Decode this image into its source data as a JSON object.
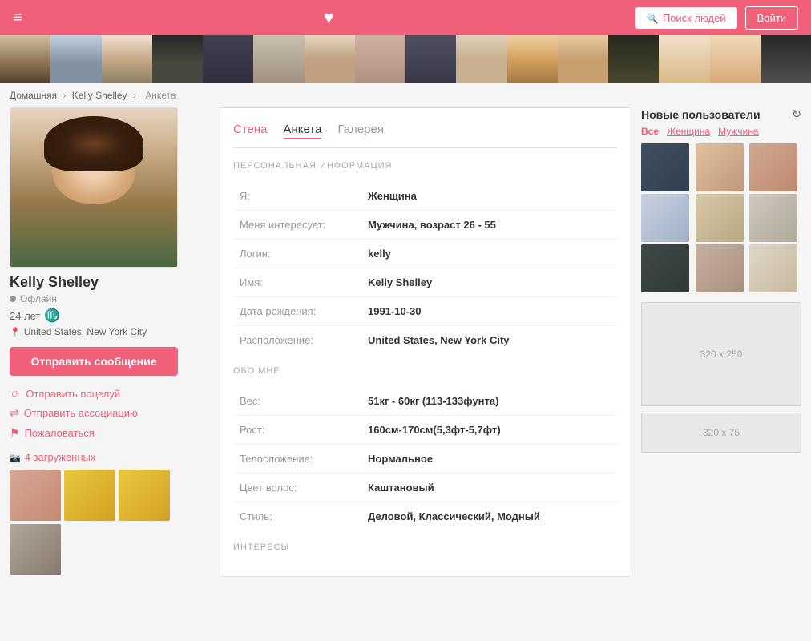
{
  "header": {
    "search_btn": "Поиск людей",
    "login_btn": "Войти",
    "heart": "♥"
  },
  "breadcrumb": {
    "home": "Домашняя",
    "sep1": ">",
    "user": "Kelly Shelley",
    "sep2": ">",
    "page": "Анкета"
  },
  "profile": {
    "name": "Kelly Shelley",
    "status": "Офлайн",
    "age": "24 лет",
    "zodiac": "♏",
    "location": "United States, New York City",
    "send_msg": "Отправить сообщение",
    "kiss_link": "Отправить поцелуй",
    "assoc_link": "Отправить ассоциацию",
    "complaint_link": "Пожаловаться",
    "photos_label": "4 загруженных"
  },
  "tabs": {
    "wall": "Стена",
    "anketa": "Анкета",
    "gallery": "Галерея"
  },
  "sections": {
    "personal_info": "ПЕРСОНАЛЬНАЯ ИНФОРМАЦИЯ",
    "about_me": "ОБО МНЕ",
    "interests": "ИНТЕРЕСЫ"
  },
  "personal_info": {
    "rows": [
      {
        "label": "Я:",
        "value": "Женщина"
      },
      {
        "label": "Меня интересует:",
        "value": "Мужчина, возраст 26 - 55"
      },
      {
        "label": "Логин:",
        "value": "kelly"
      },
      {
        "label": "Имя:",
        "value": "Kelly Shelley"
      },
      {
        "label": "Дата рождения:",
        "value": "1991-10-30"
      },
      {
        "label": "Расположение:",
        "value": "United States, New York City"
      }
    ]
  },
  "about_me": {
    "rows": [
      {
        "label": "Вес:",
        "value": "51кг - 60кг (113-133фунта)"
      },
      {
        "label": "Рост:",
        "value": "160см-170см(5,3фт-5,7фт)"
      },
      {
        "label": "Телосложение:",
        "value": "Нормальное"
      },
      {
        "label": "Цвет волос:",
        "value": "Каштановый"
      },
      {
        "label": "Стиль:",
        "value": "Деловой, Классический, Модный"
      }
    ]
  },
  "right_sidebar": {
    "title": "Новые пользователи",
    "filter_all": "Все",
    "filter_women": "Женщина",
    "filter_men": "Мужчина",
    "ad_large": "320 x 250",
    "ad_small": "320 x 75"
  }
}
